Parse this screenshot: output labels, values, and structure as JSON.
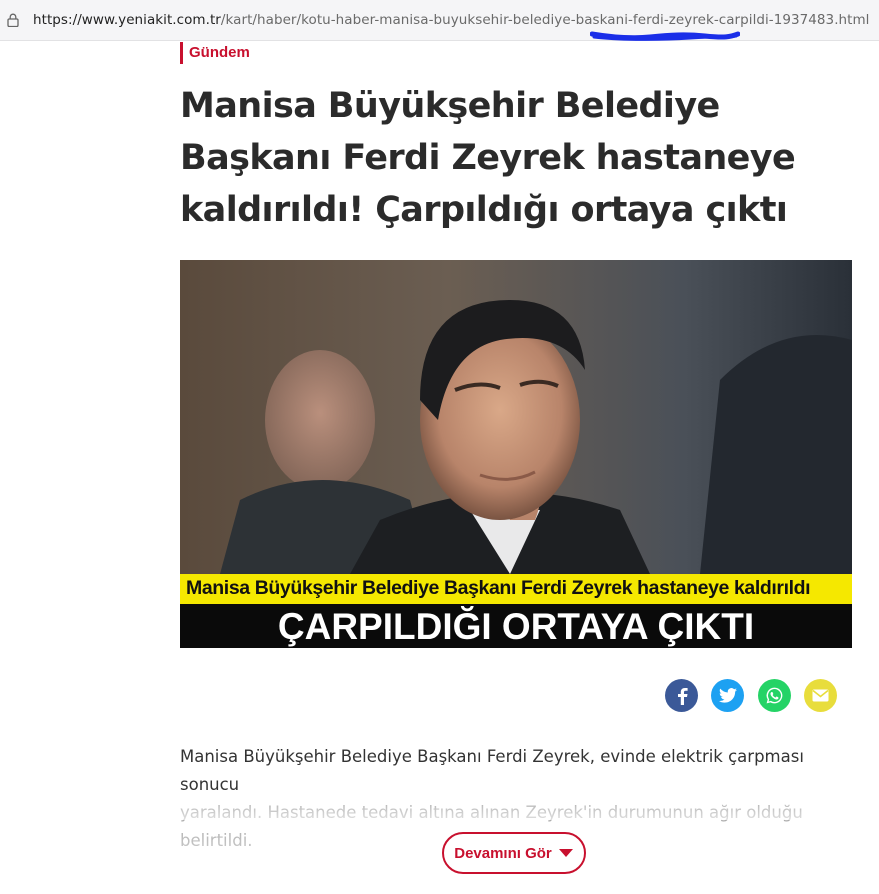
{
  "browser": {
    "url_domain": "https://www.yeniakit.com.tr",
    "url_path": "/kart/haber/kotu-haber-manisa-buyuksehir-belediye-baskani-ferdi-zeyrek-carpildi-1937483.html"
  },
  "article": {
    "category": "Gündem",
    "headline": "Manisa Büyükşehir Belediye Başkanı Ferdi Zeyrek hastaneye kaldırıldı! Çarpıldığı ortaya çıktı",
    "image_caption_top": "Manisa Büyükşehir Belediye Başkanı Ferdi Zeyrek hastaneye kaldırıldı",
    "image_caption_bottom": "ÇARPILDIĞI ORTAYA ÇIKTI",
    "body_line1": "Manisa Büyükşehir Belediye Başkanı Ferdi Zeyrek, evinde elektrik çarpması sonucu",
    "body_line2": "yaralandı. Hastanede tedavi altına alınan Zeyrek'in durumunun ağır olduğu belirtildi.",
    "read_more": "Devamını Gör"
  },
  "share": {
    "buttons": [
      {
        "icon": "facebook-icon",
        "color": "#3b5998"
      },
      {
        "icon": "twitter-icon",
        "color": "#1da1f2"
      },
      {
        "icon": "whatsapp-icon",
        "color": "#25d366"
      },
      {
        "icon": "email-icon",
        "color": "#e8dd3c"
      }
    ]
  },
  "colors": {
    "accent": "#c8102e",
    "headline": "#2b2b2b",
    "banner_yellow": "#f5e800",
    "url_annotation": "#1a2ee8"
  }
}
